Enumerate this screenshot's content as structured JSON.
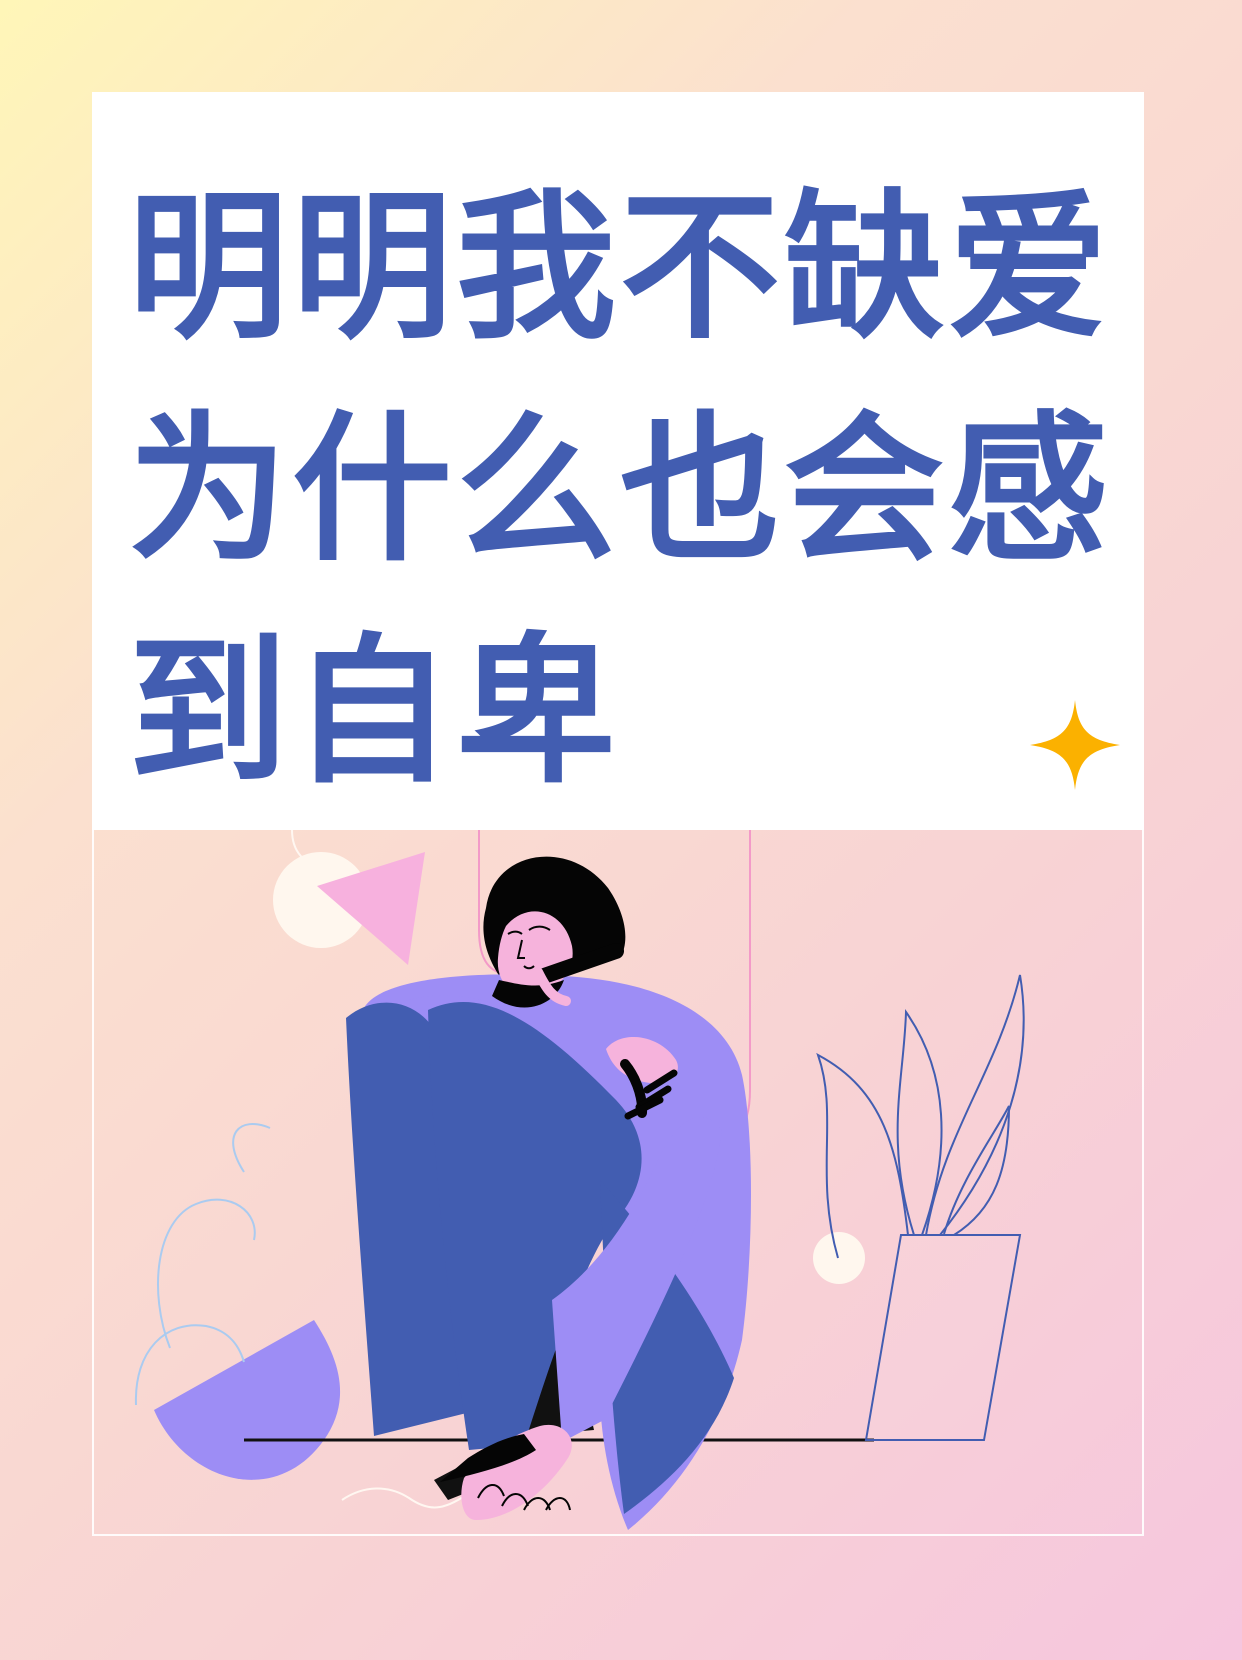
{
  "title": {
    "line1": "明明我不缺爱",
    "line2": "为什么也会感",
    "line3": "到自卑"
  },
  "colors": {
    "title": "#425db1",
    "sweater": "#9d8df5",
    "pants": "#425db1",
    "skin": "#f6b3dc",
    "hair": "#050505",
    "accent": "#fbb100"
  },
  "icons": {
    "sparkle": "sparkle-icon"
  }
}
